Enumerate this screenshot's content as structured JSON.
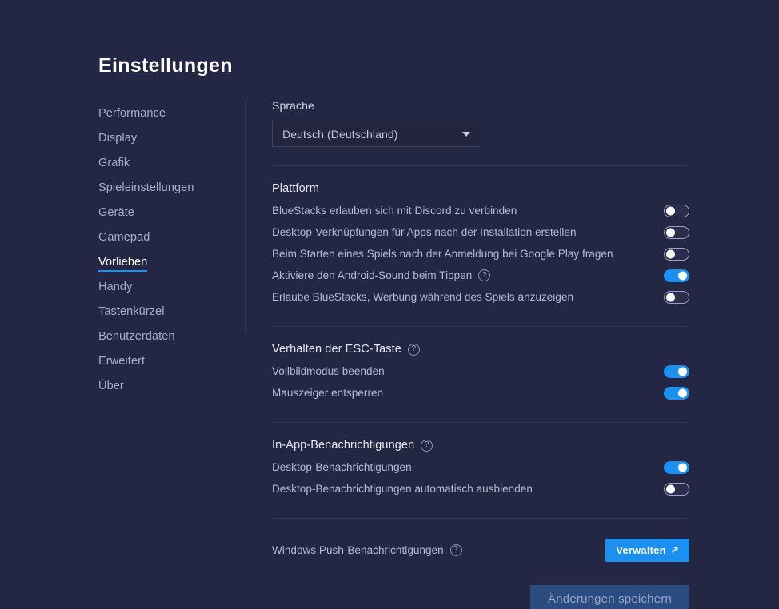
{
  "title": "Einstellungen",
  "sidebar": {
    "items": [
      {
        "label": "Performance",
        "active": false
      },
      {
        "label": "Display",
        "active": false
      },
      {
        "label": "Grafik",
        "active": false
      },
      {
        "label": "Spieleinstellungen",
        "active": false
      },
      {
        "label": "Geräte",
        "active": false
      },
      {
        "label": "Gamepad",
        "active": false
      },
      {
        "label": "Vorlieben",
        "active": true
      },
      {
        "label": "Handy",
        "active": false
      },
      {
        "label": "Tastenkürzel",
        "active": false
      },
      {
        "label": "Benutzerdaten",
        "active": false
      },
      {
        "label": "Erweitert",
        "active": false
      },
      {
        "label": "Über",
        "active": false
      }
    ]
  },
  "language": {
    "label": "Sprache",
    "selected": "Deutsch (Deutschland)",
    "icon": "chevron-down-icon"
  },
  "platform": {
    "heading": "Plattform",
    "rows": [
      {
        "label": "BlueStacks erlauben sich mit Discord zu verbinden",
        "state": "off",
        "help": false
      },
      {
        "label": "Desktop-Verknüpfungen für Apps nach der Installation erstellen",
        "state": "off",
        "help": false
      },
      {
        "label": "Beim Starten eines Spiels nach der Anmeldung bei Google Play fragen",
        "state": "off",
        "help": false
      },
      {
        "label": "Aktiviere den Android-Sound beim Tippen",
        "state": "on",
        "help": true
      },
      {
        "label": "Erlaube BlueStacks, Werbung während des Spiels anzuzeigen",
        "state": "off",
        "help": false
      }
    ]
  },
  "esc": {
    "heading": "Verhalten der ESC-Taste",
    "help": true,
    "rows": [
      {
        "label": "Vollbildmodus beenden",
        "state": "on"
      },
      {
        "label": "Mauszeiger entsperren",
        "state": "on"
      }
    ]
  },
  "inapp": {
    "heading": "In-App-Benachrichtigungen",
    "help": true,
    "rows": [
      {
        "label": "Desktop-Benachrichtigungen",
        "state": "on"
      },
      {
        "label": "Desktop-Benachrichtigungen automatisch ausblenden",
        "state": "off"
      }
    ]
  },
  "push": {
    "label": "Windows Push-Benachrichtigungen",
    "help": true,
    "button_label": "Verwalten",
    "button_icon": "external-link-icon"
  },
  "save": {
    "label": "Änderungen speichern",
    "enabled": false
  },
  "help_glyph": "?",
  "arrow_glyph": "↗",
  "colors": {
    "background": "#242744",
    "accent": "#1a91f0",
    "text_primary": "#ffffff",
    "text_secondary": "#b6bad4",
    "divider": "#32365a",
    "save_disabled_bg": "#2a4c80"
  }
}
